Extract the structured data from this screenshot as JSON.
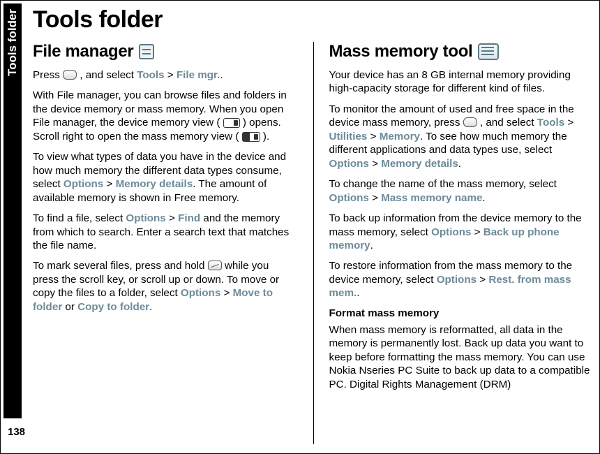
{
  "sideTab": "Tools folder",
  "pageNumber": "138",
  "title": "Tools folder",
  "left": {
    "heading": "File manager",
    "p1_a": "Press ",
    "p1_b": ", and select ",
    "p1_tools": "Tools",
    "p1_gt": " > ",
    "p1_filemgr": "File mgr.",
    "p1_c": ".",
    "p2_a": "With File manager, you can browse files and folders in the device memory or mass memory. When you open File manager, the device memory view (",
    "p2_b": ") opens. Scroll right to open the mass memory view (",
    "p2_c": ").",
    "p3_a": "To view what types of data you have in the device and how much memory the different data types consume, select ",
    "p3_opt": "Options",
    "p3_memdet": "Memory details",
    "p3_b": ". The amount of available memory is shown in Free memory.",
    "p4_a": "To find a file, select ",
    "p4_find": "Find",
    "p4_b": " and the memory from which to search. Enter a search text that matches the file name.",
    "p5_a": "To mark several files, press and hold ",
    "p5_b": " while you press the scroll key, or scroll up or down. To move or copy the files to a folder, select ",
    "p5_move": "Move to folder",
    "p5_or": " or ",
    "p5_copy": "Copy to folder",
    "p5_c": "."
  },
  "right": {
    "heading": "Mass memory tool",
    "p1": "Your device has an 8 GB internal memory providing high-capacity storage for different kind of files.",
    "p2_a": "To monitor the amount of used and free space in the device mass memory, press ",
    "p2_b": ", and select ",
    "p2_tools": "Tools",
    "p2_util": "Utilities",
    "p2_mem": "Memory",
    "p2_c": ". To see how much memory the different applications and data types use, select ",
    "p2_opt": "Options",
    "p2_memdet": "Memory details",
    "p2_d": ".",
    "p3_a": "To change the name of the mass memory, select ",
    "p3_mmname": "Mass memory name",
    "p3_b": ".",
    "p4_a": "To back up information from the device memory to the mass memory, select ",
    "p4_backup": "Back up phone memory",
    "p4_b": ".",
    "p5_a": "To restore information from the mass memory to the device memory, select ",
    "p5_rest": "Rest. from mass mem.",
    "p5_b": ".",
    "sub": "Format mass memory",
    "p6": "When mass memory is reformatted, all data in the memory is permanently lost. Back up data you want to keep before formatting the mass memory. You can use Nokia Nseries PC Suite to back up data to a compatible PC. Digital Rights Management (DRM)"
  },
  "common": {
    "gt": " > ",
    "options": "Options"
  }
}
